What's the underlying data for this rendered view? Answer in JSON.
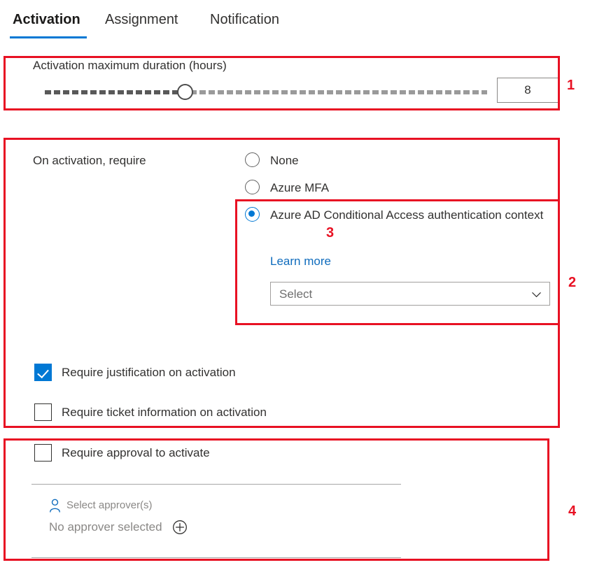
{
  "tabs": [
    {
      "label": "Activation",
      "selected": true
    },
    {
      "label": "Assignment",
      "selected": false
    },
    {
      "label": "Notification",
      "selected": false
    }
  ],
  "activation": {
    "duration": {
      "label": "Activation maximum duration (hours)",
      "value": "8",
      "slider_percent": 31
    },
    "requirement": {
      "label": "On activation, require",
      "options": [
        {
          "label": "None",
          "selected": false
        },
        {
          "label": "Azure MFA",
          "selected": false
        },
        {
          "label": "Azure AD Conditional Access authentication context",
          "selected": true
        }
      ],
      "learn_more_label": "Learn more",
      "context_select": {
        "placeholder": "Select",
        "value": "Select",
        "chevron_icon": "chevron-down-icon"
      }
    },
    "checkboxes": [
      {
        "label": "Require justification on activation",
        "checked": true
      },
      {
        "label": "Require ticket information on activation",
        "checked": false
      },
      {
        "label": "Require approval to activate",
        "checked": false
      }
    ],
    "approvers": {
      "picker_label": "Select approver(s)",
      "empty_state": "No approver selected",
      "person_icon": "person-icon",
      "add_icon": "plus-circle-icon"
    }
  },
  "annotations": [
    {
      "number": "1"
    },
    {
      "number": "2"
    },
    {
      "number": "3"
    },
    {
      "number": "4"
    }
  ],
  "colors": {
    "accent": "#0078d4",
    "link": "#0f6cbd",
    "annotation": "#e81123",
    "text": "#323130",
    "muted": "#8a8886"
  }
}
